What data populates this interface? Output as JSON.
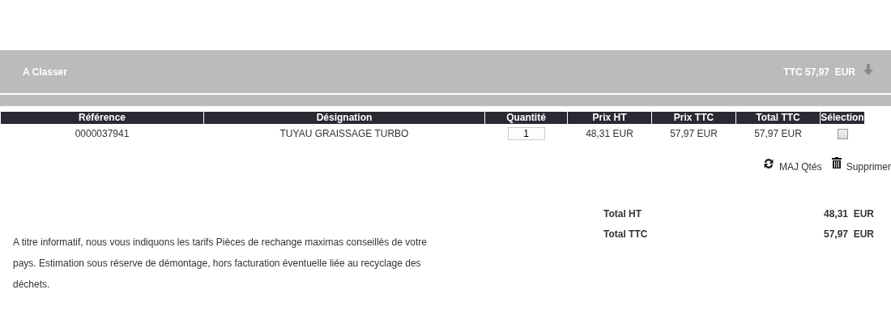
{
  "panel": {
    "title": "A Classer",
    "total": "TTC 57,97  EUR"
  },
  "table": {
    "columns": [
      "Référence",
      "Désignation",
      "Quantité",
      "Prix HT",
      "Prix TTC",
      "Total TTC",
      "Sélection"
    ],
    "rows": [
      {
        "reference": "0000037941",
        "designation": "TUYAU GRAISSAGE TURBO",
        "quantity": "1",
        "price_ht": "48,31 EUR",
        "price_ttc": "57,97 EUR",
        "total_ttc": "57,97 EUR",
        "checked": false
      }
    ]
  },
  "actions": [
    "MAJ Qtés",
    "Supprimer"
  ],
  "totals": [
    {
      "label": "Total HT",
      "value": "48,31  EUR"
    },
    {
      "label": "Total TTC",
      "value": "57,97  EUR"
    }
  ],
  "notice": "A titre informatif, nous vous indiquons les tarifs Pièces de rechange maximas conseillés de votre pays. Estimation sous réserve de démontage, hors facturation éventuelle liée au recyclage des déchets."
}
